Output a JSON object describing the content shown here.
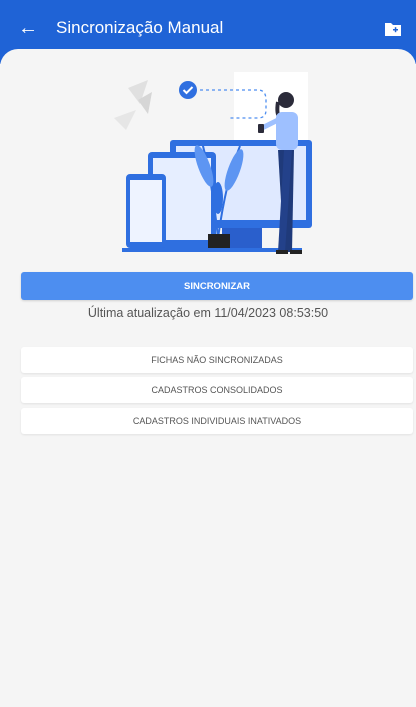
{
  "appbar": {
    "title": "Sincronização Manual",
    "back_icon": "arrow-left-icon",
    "action_icon": "folder-icon",
    "color": "#1f63d6"
  },
  "main": {
    "sync_button_label": "SINCRONIZAR",
    "last_update": "Última atualização em 11/04/2023 08:53:50",
    "list_buttons": [
      "FICHAS NÃO SINCRONIZADAS",
      "CADASTROS CONSOLIDADOS",
      "CADASTROS INDIVIDUAIS INATIVADOS"
    ],
    "accent_color": "#4d8ef0"
  }
}
